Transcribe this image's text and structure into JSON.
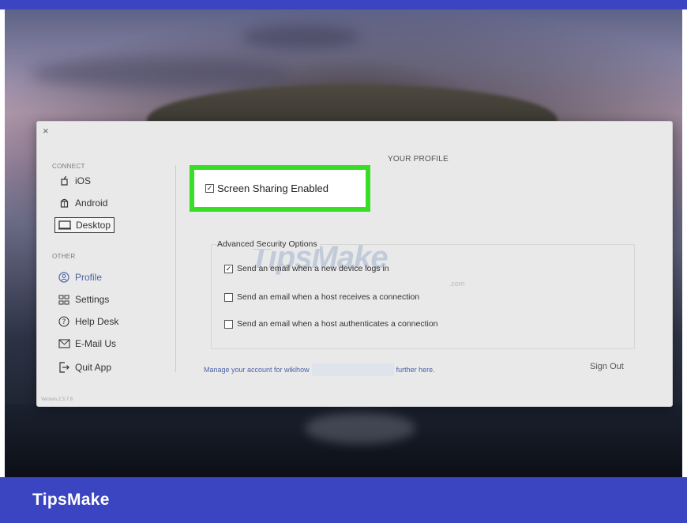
{
  "window": {
    "close_glyph": "×",
    "title": "YOUR PROFILE",
    "version": "Version 2.3.7.8"
  },
  "sidebar": {
    "connect_label": "CONNECT",
    "other_label": "OTHER",
    "connect_items": [
      {
        "label": "iOS",
        "icon": "apple-icon",
        "glyph": "д"
      },
      {
        "label": "Android",
        "icon": "android-icon",
        "glyph": "☃"
      },
      {
        "label": "Desktop",
        "icon": "desktop-icon",
        "glyph": "▭",
        "active": true
      }
    ],
    "other_items": [
      {
        "label": "Profile",
        "icon": "profile-icon",
        "glyph": "Ⓟ"
      },
      {
        "label": "Settings",
        "icon": "settings-icon",
        "glyph": "☷"
      },
      {
        "label": "Help Desk",
        "icon": "help-icon",
        "glyph": "Ⓗ"
      },
      {
        "label": "E-Mail Us",
        "icon": "email-icon",
        "glyph": "✉"
      },
      {
        "label": "Quit App",
        "icon": "quit-icon",
        "glyph": "⇥"
      }
    ]
  },
  "screen_sharing": {
    "label": "Screen Sharing Enabled",
    "checked": true,
    "check_glyph": "✓",
    "highlight_color": "#38dd26"
  },
  "advanced": {
    "title": "Advanced Security Options",
    "options": [
      {
        "label": "Send an email when a new device logs in",
        "checked": true
      },
      {
        "label": "Send an email when a host receives a connection",
        "checked": false
      },
      {
        "label": "Send an email when a host authenticates a connection",
        "checked": false
      }
    ]
  },
  "footer": {
    "manage_prefix": "Manage your account for wikihow",
    "manage_suffix": "further here.",
    "sign_out": "Sign Out"
  },
  "watermark": {
    "text": "TipsMake",
    "suffix": ".com"
  },
  "brand": {
    "name": "TipsMake",
    "color": "#3b45c1"
  }
}
